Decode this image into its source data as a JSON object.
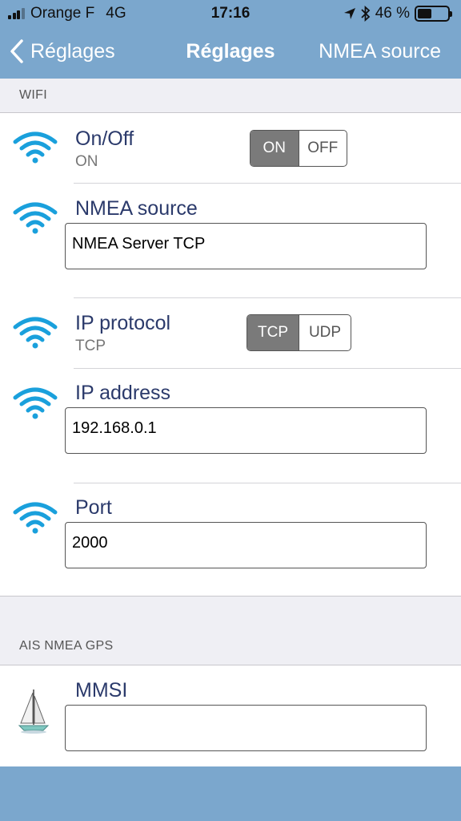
{
  "status_bar": {
    "carrier": "Orange F",
    "network": "4G",
    "time": "17:16",
    "battery_percent": "46 %",
    "battery_level": 0.46
  },
  "nav": {
    "back_label": "Réglages",
    "title": "Réglages",
    "right_label": "NMEA source"
  },
  "wifi_section": {
    "header": "WIFI",
    "onoff": {
      "title": "On/Off",
      "value": "ON",
      "options": [
        "ON",
        "OFF"
      ],
      "selected": "ON"
    },
    "nmea_source": {
      "title": "NMEA source",
      "value": "NMEA Server TCP"
    },
    "ip_protocol": {
      "title": "IP protocol",
      "value": "TCP",
      "options": [
        "TCP",
        "UDP"
      ],
      "selected": "TCP"
    },
    "ip_address": {
      "title": "IP address",
      "value": "192.168.0.1"
    },
    "port": {
      "title": "Port",
      "value": "2000"
    }
  },
  "ais_section": {
    "header": "AIS NMEA GPS",
    "mmsi": {
      "title": "MMSI",
      "value": ""
    }
  },
  "colors": {
    "bar": "#7ba7cd",
    "wifi_icon": "#1aa0dc",
    "title_text": "#2b3a6b",
    "segment_active": "#7a7a7a"
  },
  "icons": {
    "row": "wifi-icon",
    "mmsi_row": "sailboat-icon",
    "back": "chevron-left-icon"
  }
}
